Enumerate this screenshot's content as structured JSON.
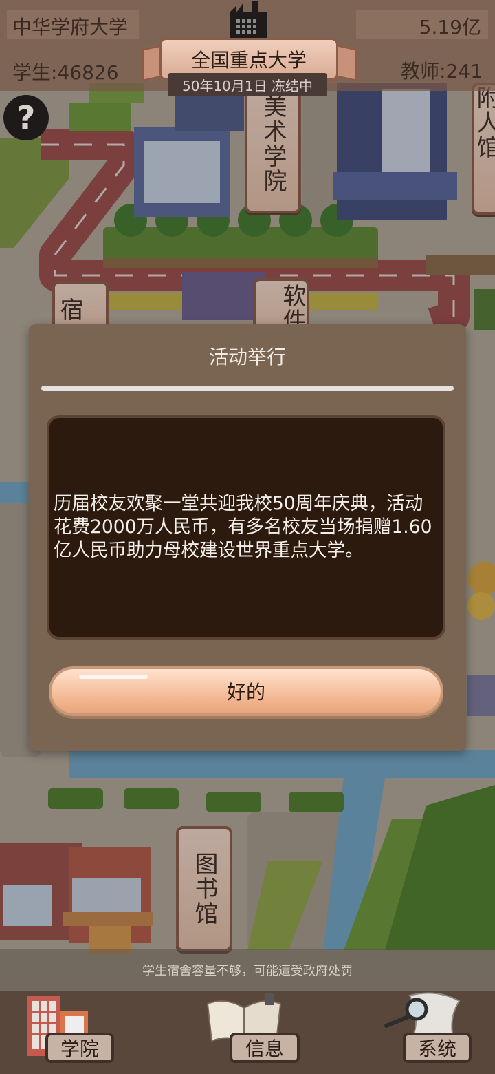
{
  "header": {
    "university_name": "中华学府大学",
    "money": "5.19亿",
    "students": "学生:46826",
    "teachers": "教师:241",
    "rank": "全国重点大学",
    "date_status": "50年10月1日 冻结中"
  },
  "map": {
    "signs": {
      "art_college": "美术学院",
      "software": "软件",
      "dorm": "宿",
      "library": "图书馆",
      "right_edge": "附人馆"
    }
  },
  "help": {
    "icon": "question-mark-icon",
    "glyph": "?"
  },
  "dialog": {
    "title": "活动举行",
    "message": "历届校友欢聚一堂共迎我校50周年庆典，活动花费2000万人民币，有多名校友当场捐赠1.60亿人民币助力母校建设世界重点大学。",
    "ok_label": "好的"
  },
  "warning": "学生宿舍容量不够，可能遭受政府处罚",
  "nav": {
    "items": [
      {
        "label": "学院",
        "icon": "college-building-icon"
      },
      {
        "label": "信息",
        "icon": "open-book-icon"
      },
      {
        "label": "系统",
        "icon": "magnifier-scroll-icon"
      }
    ]
  },
  "colors": {
    "dialog_bg": "#7a6452",
    "message_bg": "#2b1a0d",
    "button_peach": "#f2b58f",
    "nav_bg": "#5a473b"
  }
}
